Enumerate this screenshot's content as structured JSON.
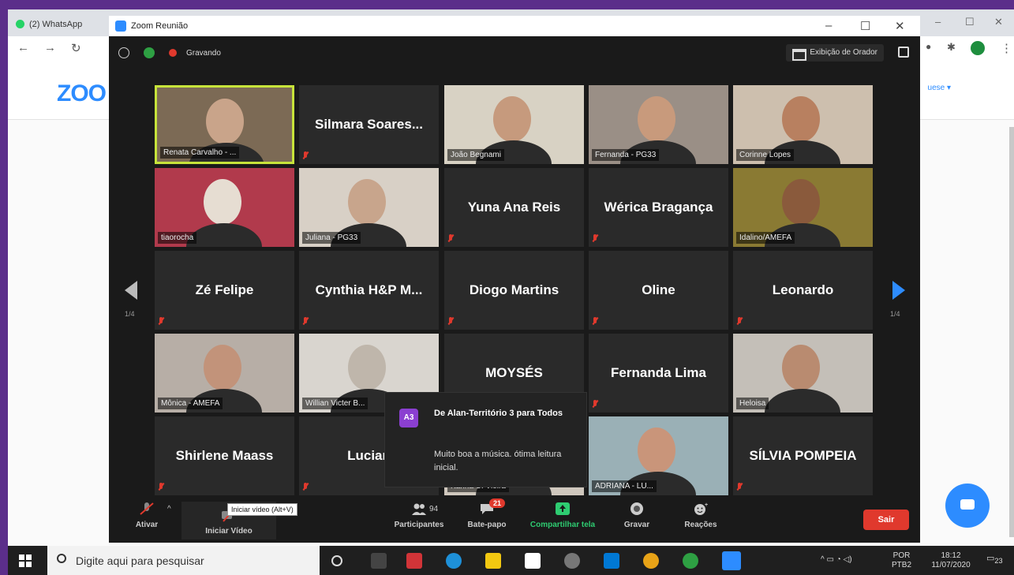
{
  "browser": {
    "tab_title": "(2) WhatsApp",
    "site_logo": "ZOO",
    "lang_label": "uese ▾"
  },
  "window": {
    "title": "Zoom Reunião",
    "minimize": "–",
    "maximize": "☐",
    "close": "✕"
  },
  "meeting": {
    "recording_label": "Gravando",
    "speaker_view_label": "Exibição de Orador",
    "page_indicator_left": "1/4",
    "page_indicator_right": "1/4"
  },
  "participants": [
    {
      "name": "Renata Carvalho - ...",
      "has_video": true,
      "active": true,
      "bg": "#7c6a55",
      "face": "#c9a48a"
    },
    {
      "name": "Silmara  Soares...",
      "has_video": false
    },
    {
      "name": "João Begnami",
      "has_video": true,
      "bg": "#d8d2c4",
      "face": "#c69a7d"
    },
    {
      "name": "Fernanda - PG33",
      "has_video": true,
      "bg": "#9a8f86",
      "face": "#c89a7c"
    },
    {
      "name": "Corinne Lopes",
      "has_video": true,
      "bg": "#cdbfae",
      "face": "#b88060"
    },
    {
      "name": "tiaorocha",
      "has_video": true,
      "bg": "#b13a4c",
      "face": "#e6ddd2"
    },
    {
      "name": "Juliana - PG33",
      "has_video": true,
      "bg": "#d8d0c6",
      "face": "#c8a58c"
    },
    {
      "name": "Yuna Ana Reis",
      "has_video": false
    },
    {
      "name": "Wérica Bragança",
      "has_video": false
    },
    {
      "name": "Idalino/AMEFA",
      "has_video": true,
      "bg": "#8a7a33",
      "face": "#8a5a3c"
    },
    {
      "name": "Zé Felipe",
      "has_video": false
    },
    {
      "name": "Cynthia H&P M...",
      "has_video": false
    },
    {
      "name": "Diogo Martins",
      "has_video": false
    },
    {
      "name": "Oline",
      "has_video": false
    },
    {
      "name": "Leonardo",
      "has_video": false
    },
    {
      "name": "Mônica - AMEFA",
      "has_video": true,
      "bg": "#b7aea6",
      "face": "#c2937a"
    },
    {
      "name": "Willian Victer B...",
      "has_video": true,
      "bg": "#d9d5cf",
      "face": "#bfb6ab"
    },
    {
      "name": "MOYSÉS",
      "has_video": false
    },
    {
      "name": "Fernanda Lima",
      "has_video": false
    },
    {
      "name": "Heloisa",
      "has_video": true,
      "bg": "#c4bfb8",
      "face": "#b98b70"
    },
    {
      "name": "Shirlene Maass",
      "has_video": false
    },
    {
      "name": "Lucian",
      "has_video": false
    },
    {
      "name": "Karina C. Vieira",
      "has_video": true,
      "bg": "#cfc7bd",
      "face": "#cbb8a4"
    },
    {
      "name": "ADRIANA - LU...",
      "has_video": true,
      "bg": "#9ab0b6",
      "face": "#c9957a"
    },
    {
      "name": "SÍLVIA POMPEIA",
      "has_video": false
    }
  ],
  "chat_notification": {
    "avatar": "A3",
    "from": "De Alan-Território 3 para Todos",
    "message": "Muito boa a música. ótima leitura inicial."
  },
  "toolbar": {
    "unmute": "Ativar",
    "start_video": "Iniciar Vídeo",
    "video_tooltip": "Iniciar vídeo (Alt+V)",
    "participants": "Participantes",
    "participants_count": "94",
    "chat": "Bate-papo",
    "chat_badge": "21",
    "share": "Compartilhar tela",
    "record": "Gravar",
    "reactions": "Reações",
    "leave": "Sair"
  },
  "taskbar": {
    "search_placeholder": "Digite aqui para pesquisar",
    "lang_top": "POR",
    "lang_bottom": "PTB2",
    "time": "18:12",
    "date": "11/07/2020",
    "notifications": "23"
  },
  "colors": {
    "zoom_blue": "#2d8cff",
    "active_speaker": "#c7e33a",
    "leave_red": "#e0392d",
    "desktop_purple": "#5b2e8a"
  }
}
